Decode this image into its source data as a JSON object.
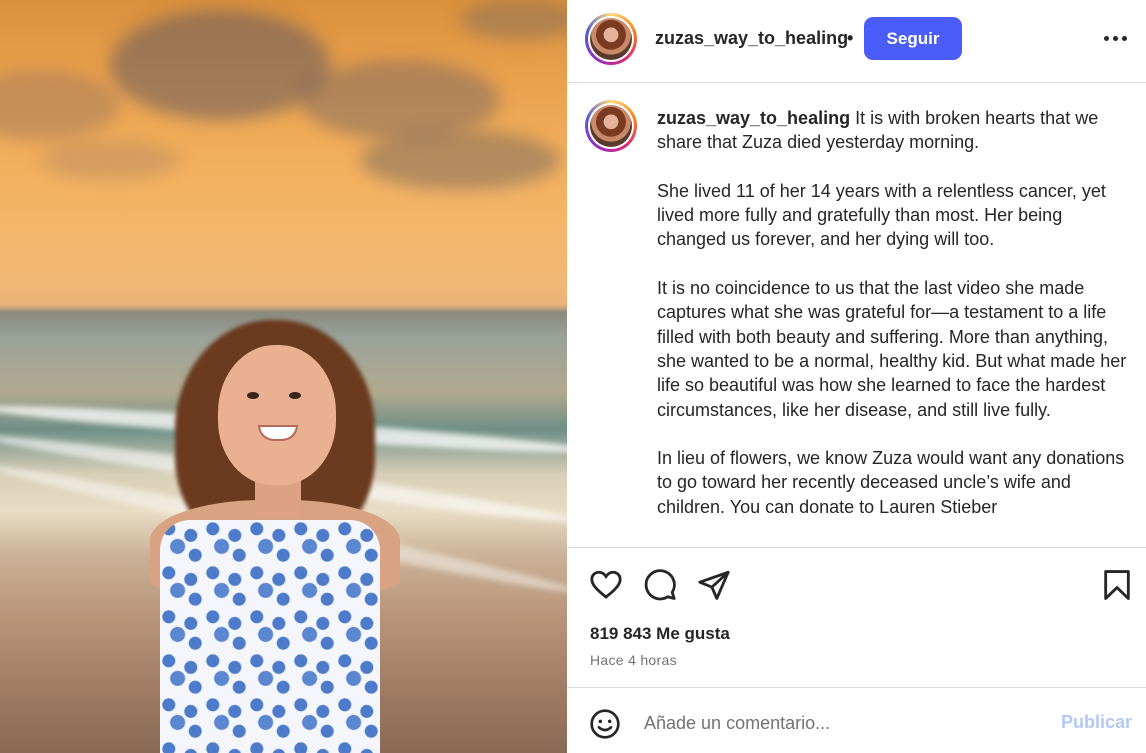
{
  "post": {
    "username": "zuzas_way_to_healing",
    "separator": "•",
    "follow_label": "Seguir",
    "caption": {
      "username": "zuzas_way_to_healing",
      "paragraphs": [
        "It is with broken hearts that we share that Zuza died yesterday morning.",
        "She lived 11 of her 14 years with a relentless cancer, yet lived more fully and gratefully than most. Her being changed us forever, and her dying will too.",
        "It is no coincidence to us that the last video she made captures what she was grateful for—a testament to a life filled with both beauty and suffering. More than anything, she wanted to be a normal, healthy kid. But what made her life so beautiful was how she learned to face the hardest circumstances, like her disease, and still live fully.",
        "In lieu of flowers, we know Zuza would want any donations to go toward her recently deceased uncle’s wife and children. You can donate to Lauren Stieber"
      ]
    },
    "likes": "819 843 Me gusta",
    "time": "Hace 4 horas",
    "comment": {
      "placeholder": "Añade un comentario...",
      "publish_label": "Publicar"
    }
  },
  "icons": {
    "like": "heart-icon",
    "comment": "comment-icon",
    "share": "send-icon",
    "save": "bookmark-icon",
    "more": "more-options-icon",
    "emoji": "emoji-icon"
  },
  "colors": {
    "follow_button": "#4a5df9",
    "publish_disabled": "#b3c8f7",
    "text": "#262626",
    "secondary_text": "#737373",
    "divider": "#dbdbdb"
  }
}
